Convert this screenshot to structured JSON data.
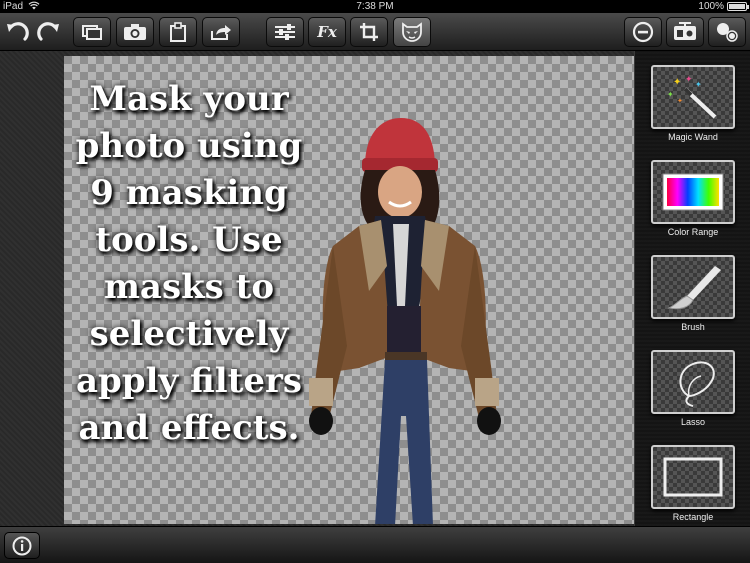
{
  "status": {
    "device": "iPad",
    "wifi_icon": "wifi-icon",
    "time": "7:38 PM",
    "battery_text": "100%",
    "battery_level": 1.0
  },
  "toolbar": {
    "buttons": [
      "undo",
      "redo",
      "layers",
      "camera",
      "clipboard",
      "share",
      "adjustments",
      "effects",
      "crop",
      "mask",
      "remove",
      "compare",
      "blend"
    ],
    "fx_label": "Fx",
    "active": "mask"
  },
  "canvas": {
    "caption": "Mask your photo using 9 masking tools. Use masks to selectively apply filters and effects."
  },
  "tools": [
    {
      "label": "Magic Wand",
      "icon": "magic-wand-icon"
    },
    {
      "label": "Color Range",
      "icon": "color-range-icon"
    },
    {
      "label": "Brush",
      "icon": "brush-icon"
    },
    {
      "label": "Lasso",
      "icon": "lasso-icon"
    },
    {
      "label": "Rectangle",
      "icon": "rectangle-icon"
    }
  ],
  "colors": {
    "toolbar_top": "#4a4a4a",
    "panel_bg": "#141414",
    "checker_light": "#b4b4b4",
    "checker_dark": "#8e8e8e",
    "hat": "#c0343b",
    "jacket": "#7a5232",
    "jeans": "#2e3f66"
  }
}
